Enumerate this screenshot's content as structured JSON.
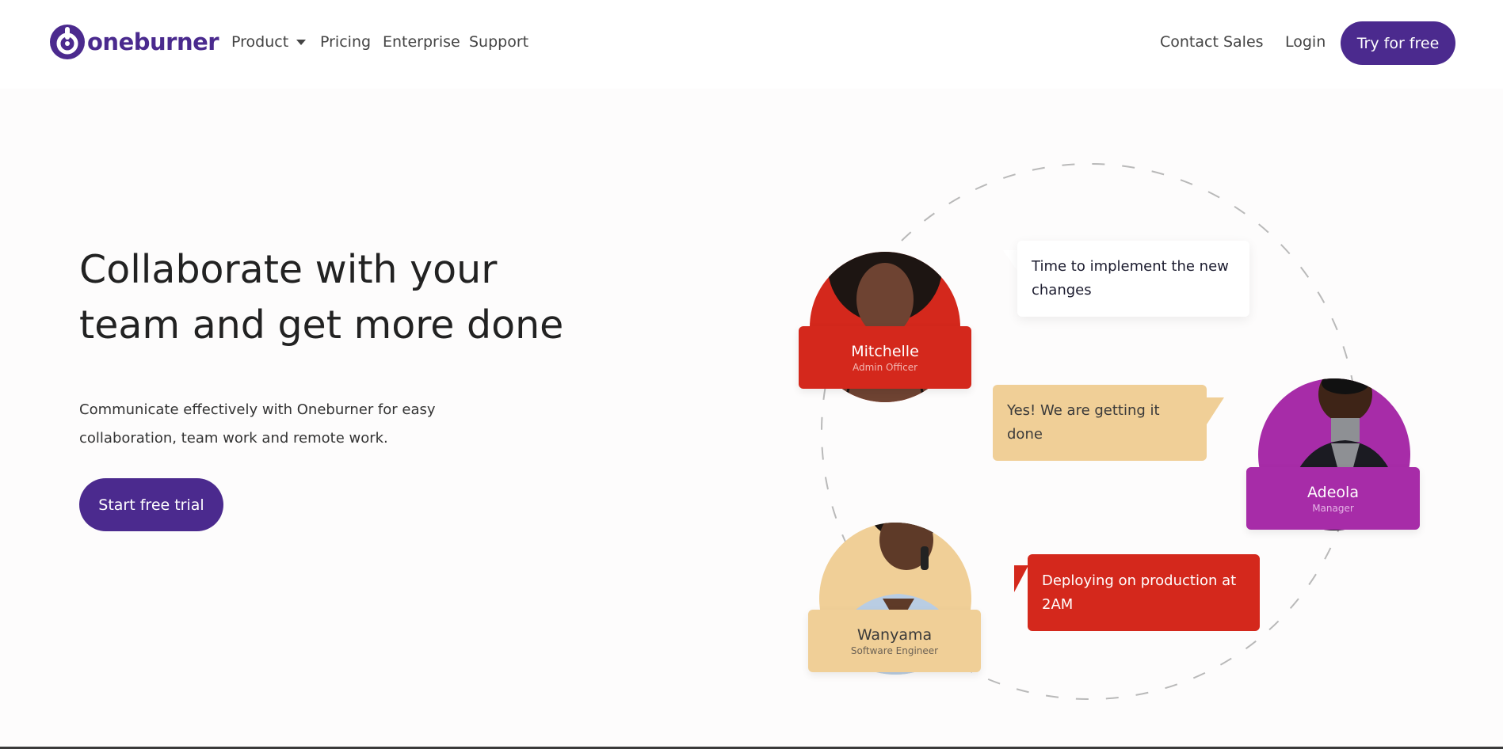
{
  "brand": {
    "name": "oneburner",
    "color": "#4b2a8e"
  },
  "nav": {
    "product": "Product",
    "pricing": "Pricing",
    "enterprise": "Enterprise",
    "support": "Support",
    "contact_sales": "Contact Sales",
    "login": "Login",
    "try_free": "Try for free"
  },
  "hero": {
    "title": "Collaborate with your team and get more done",
    "subtitle": "Communicate effectively with Oneburner for easy collaboration, team work and remote work.",
    "cta": "Start free trial"
  },
  "people": [
    {
      "name": "Mitchelle",
      "role": "Admin Officer",
      "color": "#d4281c"
    },
    {
      "name": "Adeola",
      "role": "Manager",
      "color": "#a72ca8"
    },
    {
      "name": "Wanyama",
      "role": "Software Engineer",
      "color": "#f0cf97"
    }
  ],
  "messages": [
    {
      "text": "Time to implement the new changes"
    },
    {
      "text": "Yes! We are getting it done"
    },
    {
      "text": "Deploying on production at 2AM"
    }
  ],
  "icons": [
    "oneburner-logo-icon",
    "chevron-down-icon"
  ]
}
